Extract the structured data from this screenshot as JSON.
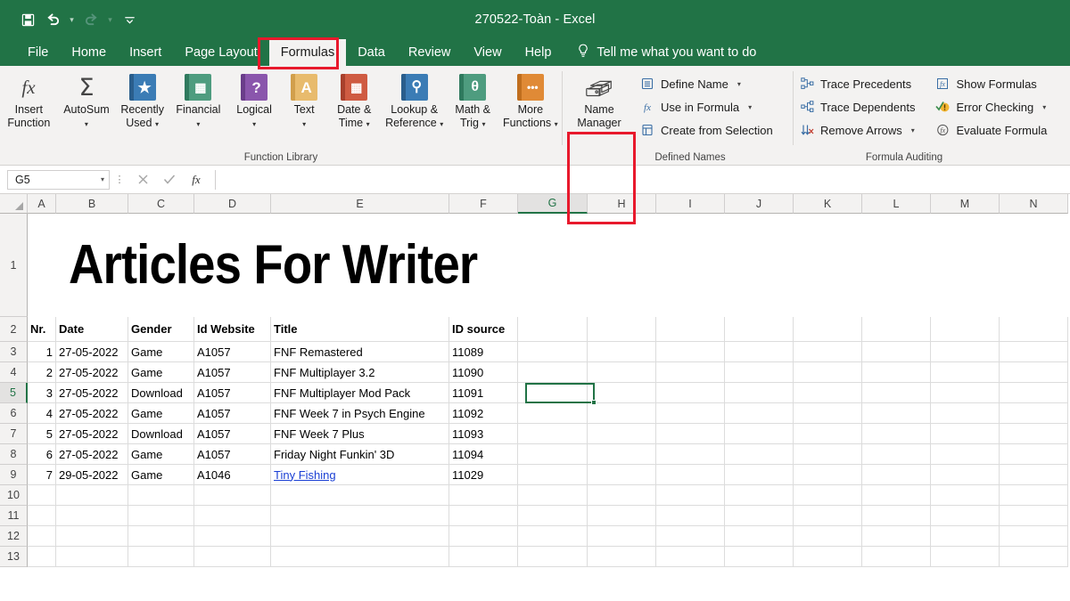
{
  "window": {
    "title": "270522-Toàn  -  Excel",
    "accent": "#217346",
    "highlight_color": "#e8192c"
  },
  "quick_access": [
    {
      "name": "save-icon",
      "label": "Save"
    },
    {
      "name": "undo-icon",
      "label": "Undo"
    },
    {
      "name": "redo-icon",
      "label": "Redo"
    },
    {
      "name": "customize-quick-access-toolbar-icon",
      "label": "Customize Quick Access Toolbar"
    }
  ],
  "tabs": [
    {
      "label": "File",
      "active": false
    },
    {
      "label": "Home",
      "active": false
    },
    {
      "label": "Insert",
      "active": false
    },
    {
      "label": "Page Layout",
      "active": false
    },
    {
      "label": "Formulas",
      "active": true
    },
    {
      "label": "Data",
      "active": false
    },
    {
      "label": "Review",
      "active": false
    },
    {
      "label": "View",
      "active": false
    },
    {
      "label": "Help",
      "active": false
    }
  ],
  "tell_me": "Tell me what you want to do",
  "ribbon": {
    "function_library": {
      "label": "Function Library",
      "buttons": [
        {
          "label_line1": "Insert",
          "label_line2": "Function",
          "icon": "fx-icon",
          "caret": false,
          "color": "#ffffff"
        },
        {
          "label_line1": "AutoSum",
          "label_line2": "",
          "icon": "sigma-icon",
          "caret": true,
          "color": "#ffffff"
        },
        {
          "label_line1": "Recently",
          "label_line2": "Used",
          "icon": "star-book-icon",
          "caret": true,
          "color": "#3b7cb5",
          "spine": "#2a5e8c",
          "glyph": "★"
        },
        {
          "label_line1": "Financial",
          "label_line2": "",
          "icon": "financial-book-icon",
          "caret": true,
          "color": "#4e9c7f",
          "spine": "#2f7a5e",
          "glyph": "▤"
        },
        {
          "label_line1": "Logical",
          "label_line2": "",
          "icon": "logical-book-icon",
          "caret": true,
          "color": "#8a56ac",
          "spine": "#6a3d8a",
          "glyph": "?"
        },
        {
          "label_line1": "Text",
          "label_line2": "",
          "icon": "text-book-icon",
          "caret": true,
          "color": "#e8bb6d",
          "spine": "#d19f4c",
          "glyph": "A"
        },
        {
          "label_line1": "Date &",
          "label_line2": "Time",
          "icon": "date-time-book-icon",
          "caret": true,
          "color": "#cf5b42",
          "spine": "#a8402c",
          "glyph": "▦"
        },
        {
          "label_line1": "Lookup &",
          "label_line2": "Reference",
          "icon": "lookup-book-icon",
          "caret": true,
          "color": "#3b7cb5",
          "spine": "#2a5e8c",
          "glyph": "⌕"
        },
        {
          "label_line1": "Math &",
          "label_line2": "Trig",
          "icon": "math-trig-book-icon",
          "caret": true,
          "color": "#4e9c7f",
          "spine": "#2f7a5e",
          "glyph": "θ"
        },
        {
          "label_line1": "More",
          "label_line2": "Functions",
          "icon": "more-functions-book-icon",
          "caret": true,
          "color": "#e08a36",
          "spine": "#c06e1e",
          "glyph": "•••"
        }
      ]
    },
    "defined_names": {
      "label": "Defined Names",
      "name_manager": {
        "label_line1": "Name",
        "label_line2": "Manager",
        "icon": "name-manager-icon",
        "highlighted": true
      },
      "items": [
        {
          "label": "Define Name",
          "icon": "define-name-icon",
          "caret": true
        },
        {
          "label": "Use in Formula",
          "icon": "use-in-formula-icon",
          "caret": true
        },
        {
          "label": "Create from Selection",
          "icon": "create-from-selection-icon",
          "caret": false
        }
      ]
    },
    "formula_auditing": {
      "label": "Formula Auditing",
      "column_one": [
        {
          "label": "Trace Precedents",
          "icon": "trace-precedents-icon",
          "caret": false
        },
        {
          "label": "Trace Dependents",
          "icon": "trace-dependents-icon",
          "caret": false
        },
        {
          "label": "Remove Arrows",
          "icon": "remove-arrows-icon",
          "caret": true
        }
      ],
      "column_two": [
        {
          "label": "Show Formulas",
          "icon": "show-formulas-icon",
          "caret": false
        },
        {
          "label": "Error Checking",
          "icon": "error-checking-icon",
          "caret": true
        },
        {
          "label": "Evaluate Formula",
          "icon": "evaluate-formula-icon",
          "caret": false
        }
      ]
    }
  },
  "formula_bar": {
    "name_box_value": "G5",
    "formula_value": "",
    "cancel_icon": "cancel-icon",
    "enter_icon": "enter-icon",
    "insert_function_icon": "insert-function-icon"
  },
  "sheet": {
    "columns": [
      "A",
      "B",
      "C",
      "D",
      "E",
      "F",
      "G",
      "H",
      "I",
      "J",
      "K",
      "L",
      "M",
      "N"
    ],
    "selected_column": "G",
    "selected_row": "5",
    "selected_cell": "G5",
    "rows": [
      "1",
      "2",
      "3",
      "4",
      "5",
      "6",
      "7",
      "8",
      "9",
      "10",
      "11",
      "12",
      "13"
    ],
    "banner_text": "Articles For Writer",
    "headers": [
      "Nr.",
      "Date",
      "Gender",
      "Id Website",
      "Title",
      "ID source"
    ],
    "data": [
      {
        "nr": "1",
        "date": "27-05-2022",
        "gender": "Game",
        "id_website": "A1057",
        "title": "FNF Remastered",
        "id_source": "11089",
        "link": false
      },
      {
        "nr": "2",
        "date": "27-05-2022",
        "gender": "Game",
        "id_website": "A1057",
        "title": "FNF Multiplayer 3.2",
        "id_source": "11090",
        "link": false
      },
      {
        "nr": "3",
        "date": "27-05-2022",
        "gender": "Download",
        "id_website": "A1057",
        "title": "FNF Multiplayer Mod Pack",
        "id_source": "11091",
        "link": false
      },
      {
        "nr": "4",
        "date": "27-05-2022",
        "gender": "Game",
        "id_website": "A1057",
        "title": "FNF Week 7 in Psych Engine",
        "id_source": "11092",
        "link": false
      },
      {
        "nr": "5",
        "date": "27-05-2022",
        "gender": "Download",
        "id_website": "A1057",
        "title": "FNF Week 7 Plus",
        "id_source": "11093",
        "link": false
      },
      {
        "nr": "6",
        "date": "27-05-2022",
        "gender": "Game",
        "id_website": "A1057",
        "title": "Friday Night Funkin' 3D",
        "id_source": "11094",
        "link": false
      },
      {
        "nr": "7",
        "date": "29-05-2022",
        "gender": "Game",
        "id_website": "A1046",
        "title": "Tiny Fishing",
        "id_source": "11029",
        "link": true
      }
    ]
  }
}
